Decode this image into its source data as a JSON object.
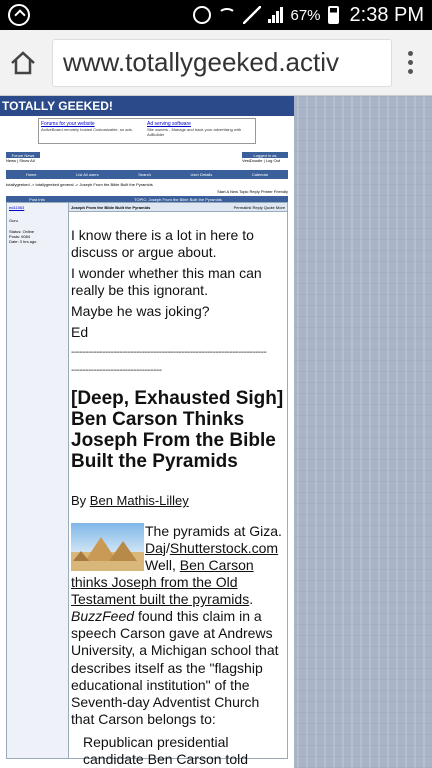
{
  "status_bar": {
    "battery": "67%",
    "time": "2:38 PM"
  },
  "browser": {
    "url": "www.totallygeeked.activ"
  },
  "forum": {
    "title": "TOTALLY GEEKED!",
    "ads": [
      {
        "link": "Forums for your website",
        "text": "ActiveBoard remotely hosted Customizable, no ads."
      },
      {
        "link": "Ad serving software",
        "text": "Site owners - Manage and track your advertising with AdBuilder"
      }
    ],
    "forum_news": "Forum News",
    "logged_in": "Logged in as",
    "news_links": "News | Show All",
    "user_links": "VestDoodle | Log Out",
    "nav": [
      "Home",
      "List All users",
      "Search",
      "User Details",
      "Calendar"
    ],
    "breadcrumb": "totallygeeked -> totallygeeked general -> Joseph From the Bible Built the Pyramids",
    "actions": "Start A New Topic   Reply   Printer Friendly",
    "col_post_info": "Post Info",
    "col_topic": "TOPIC: Joseph From the Bible Built the Pyramids",
    "post_title": "Joseph From the Bible Built the Pyramids",
    "post_tools": "Permalink  Reply  Quote  More",
    "author": "ed11563",
    "author_rank": "Guru",
    "author_status": "Status: Online",
    "author_posts": "Posts: 6084",
    "author_date": "Date: 3 hrs ago"
  },
  "post": {
    "p1": "I know there is a lot in here to discuss or argue about.",
    "p2": "I wonder whether this man can really be this ignorant.",
    "p3": "Maybe he was joking?",
    "p4": "Ed",
    "dash1": "---------------------------------------------------------------------",
    "dash2": "--------------------------------",
    "headline": "[Deep, Exhausted Sigh] Ben Carson Thinks Joseph From the Bible Built the Pyramids",
    "byline_by": "By",
    "byline_author": "Ben Mathis-Lilley",
    "caption_a": "The pyramids at Giza.",
    "caption_b_link1": "Daj",
    "caption_b_sep": "/",
    "caption_b_link2": "Shutterstock.com",
    "lead_well": "Well,",
    "lead_link": "Ben Carson thinks Joseph from the Old Testament built the pyramids",
    "lead_period": ".",
    "lead_source": "BuzzFeed",
    "lead_rest": "found this claim in a speech Carson gave at Andrews University, a Michigan school that describes itself as the \"flagship educational institution\" of the Seventh-day Adventist Church that Carson belongs to:",
    "quote": "Republican presidential candidate Ben Carson told graduates during a"
  }
}
